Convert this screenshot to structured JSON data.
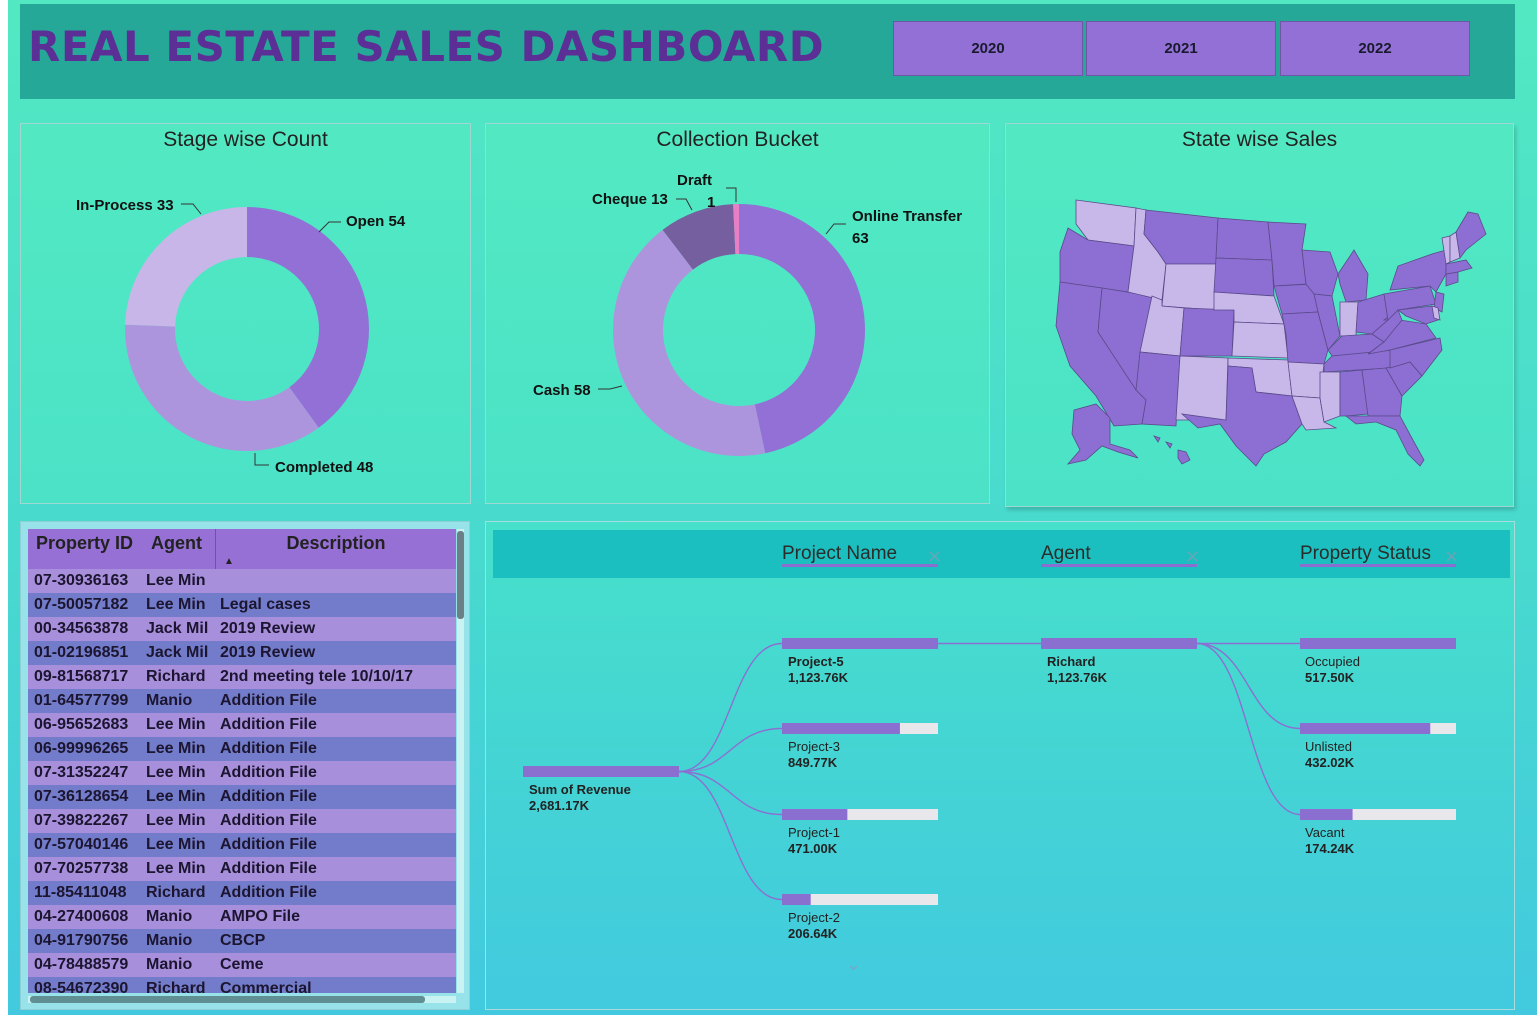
{
  "header": {
    "title": "REAL ESTATE SALES DASHBOARD",
    "years": [
      "2020",
      "2021",
      "2022"
    ]
  },
  "colors": {
    "accent": "#9270d6",
    "title": "#5b2f95",
    "header_bg": "#25a898",
    "map_fill_dark": "#8d6ed2",
    "map_fill_light": "#c8b8ea"
  },
  "stage_panel": {
    "title": "Stage wise Count"
  },
  "collection_panel": {
    "title": "Collection Bucket"
  },
  "map_panel": {
    "title": "State wise Sales"
  },
  "chart_data": [
    {
      "type": "pie",
      "title": "Stage wise Count",
      "series": [
        {
          "name": "Open",
          "value": 54,
          "label": "Open 54",
          "color": "#9270d6"
        },
        {
          "name": "Completed",
          "value": 48,
          "label": "Completed 48",
          "color": "#ad95dd"
        },
        {
          "name": "In-Process",
          "value": 33,
          "label": "In-Process 33",
          "color": "#c8b6e8"
        }
      ]
    },
    {
      "type": "pie",
      "title": "Collection Bucket",
      "series": [
        {
          "name": "Online Transfer",
          "value": 63,
          "label": "Online Transfer",
          "label2": "63",
          "color": "#9270d6"
        },
        {
          "name": "Cash",
          "value": 58,
          "label": "Cash 58",
          "label2": "",
          "color": "#ad95dd"
        },
        {
          "name": "Cheque",
          "value": 13,
          "label": "Cheque 13",
          "label2": "",
          "color": "#765f9e"
        },
        {
          "name": "Draft",
          "value": 1,
          "label": "Draft",
          "label2": "1",
          "color": "#e77fc4"
        }
      ]
    }
  ],
  "table": {
    "columns": [
      "Property ID",
      "Agent",
      "Description"
    ],
    "sort_indicator": "▲",
    "rows": [
      [
        "07-30936163",
        "Lee Min",
        ""
      ],
      [
        "07-50057182",
        "Lee Min",
        "Legal cases"
      ],
      [
        "00-34563878",
        "Jack Mil",
        "2019 Review"
      ],
      [
        "01-02196851",
        "Jack Mil",
        "2019 Review"
      ],
      [
        "09-81568717",
        "Richard",
        "2nd meeting tele 10/10/17"
      ],
      [
        "01-64577799",
        "Manio",
        "Addition File"
      ],
      [
        "06-95652683",
        "Lee Min",
        "Addition File"
      ],
      [
        "06-99996265",
        "Lee Min",
        "Addition File"
      ],
      [
        "07-31352247",
        "Lee Min",
        "Addition File"
      ],
      [
        "07-36128654",
        "Lee Min",
        "Addition File"
      ],
      [
        "07-39822267",
        "Lee Min",
        "Addition File"
      ],
      [
        "07-57040146",
        "Lee Min",
        "Addition File"
      ],
      [
        "07-70257738",
        "Lee Min",
        "Addition File"
      ],
      [
        "11-85411048",
        "Richard",
        "Addition File"
      ],
      [
        "04-27400608",
        "Manio",
        "AMPO File"
      ],
      [
        "04-91790756",
        "Manio",
        "CBCP"
      ],
      [
        "04-78488579",
        "Manio",
        "Ceme"
      ],
      [
        "08-54672390",
        "Richard",
        "Commercial"
      ]
    ]
  },
  "tree": {
    "levels": [
      "Project Name",
      "Agent",
      "Property Status"
    ],
    "close_glyph": "×",
    "expand_glyph": "⌄",
    "root": {
      "name": "Sum of Revenue",
      "value": "2,681.17K",
      "fraction": 1.0
    },
    "projects": [
      {
        "name": "Project-5",
        "value": "1,123.76K",
        "fraction": 1.0,
        "selected": true
      },
      {
        "name": "Project-3",
        "value": "849.77K",
        "fraction": 0.756
      },
      {
        "name": "Project-1",
        "value": "471.00K",
        "fraction": 0.419
      },
      {
        "name": "Project-2",
        "value": "206.64K",
        "fraction": 0.184
      }
    ],
    "agents": [
      {
        "name": "Richard",
        "value": "1,123.76K",
        "fraction": 1.0,
        "selected": true
      }
    ],
    "statuses": [
      {
        "name": "Occupied",
        "value": "517.50K",
        "fraction": 1.0
      },
      {
        "name": "Unlisted",
        "value": "432.02K",
        "fraction": 0.835
      },
      {
        "name": "Vacant",
        "value": "174.24K",
        "fraction": 0.337
      }
    ]
  }
}
